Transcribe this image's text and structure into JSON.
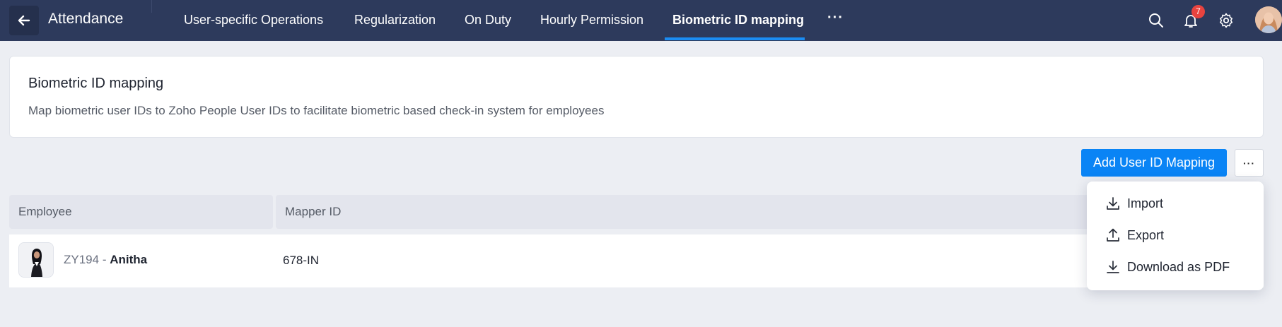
{
  "topbar": {
    "app_title": "Attendance",
    "tabs": [
      {
        "label": "User-specific Operations",
        "active": false
      },
      {
        "label": "Regularization",
        "active": false
      },
      {
        "label": "On Duty",
        "active": false
      },
      {
        "label": "Hourly Permission",
        "active": false
      },
      {
        "label": "Biometric ID mapping",
        "active": true
      }
    ],
    "more_label": "···",
    "notification_count": "7",
    "icons": [
      "back-arrow-icon",
      "search-icon",
      "bell-icon",
      "gear-icon"
    ]
  },
  "info_card": {
    "title": "Biometric ID mapping",
    "description": "Map biometric user IDs to Zoho People User IDs to facilitate biometric based check-in system for employees"
  },
  "actions": {
    "add_button": "Add User ID Mapping",
    "more_button": "···"
  },
  "table": {
    "columns": [
      "Employee",
      "Mapper ID"
    ],
    "rows": [
      {
        "employee_id": "ZY194",
        "separator": " - ",
        "employee_name": "Anitha",
        "mapper_id": "678-IN"
      }
    ]
  },
  "dropdown": {
    "items": [
      {
        "label": "Import",
        "icon": "download-icon"
      },
      {
        "label": "Export",
        "icon": "upload-icon"
      },
      {
        "label": "Download as PDF",
        "icon": "download-icon"
      }
    ]
  },
  "colors": {
    "topbar_bg": "#2d3a5c",
    "accent": "#0a84f5",
    "badge": "#e8433f",
    "page_bg": "#eceef3"
  }
}
